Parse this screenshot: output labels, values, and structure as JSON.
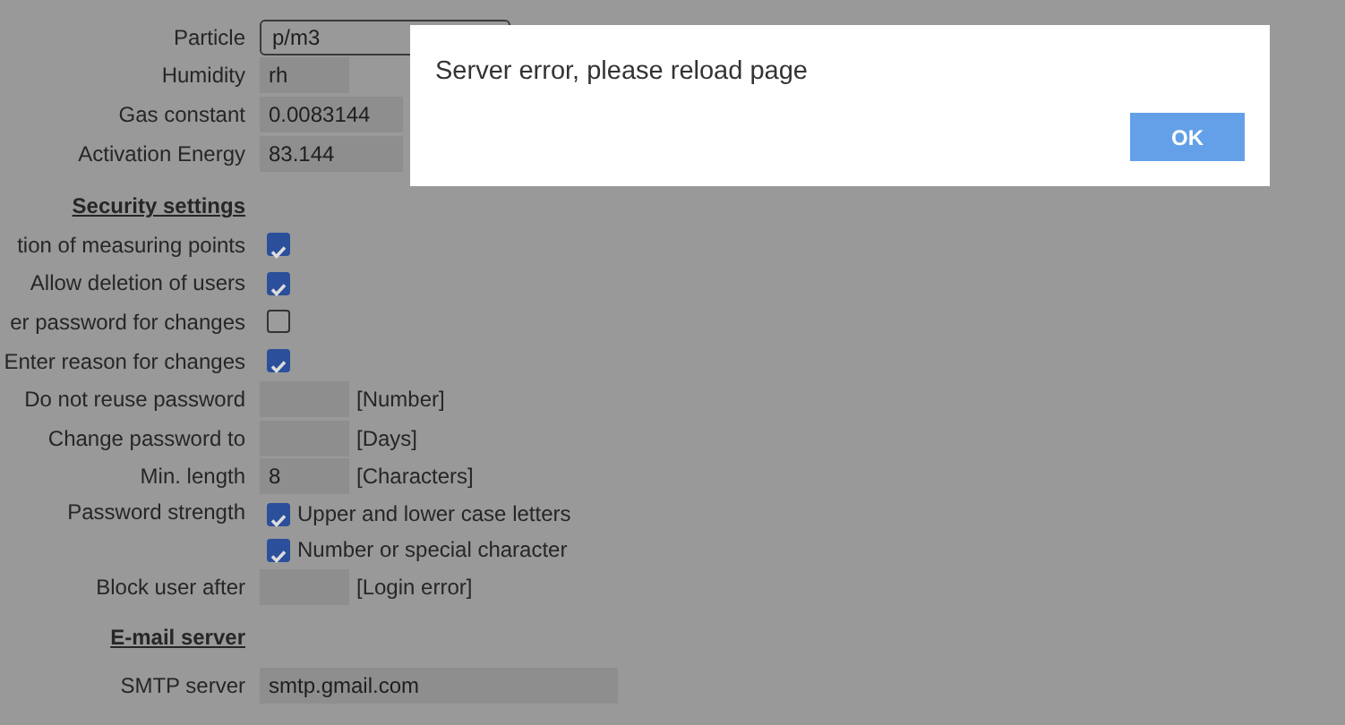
{
  "form": {
    "rows": [
      {
        "kind": "select",
        "label": "Particle",
        "value": "p/m3"
      },
      {
        "kind": "field",
        "label": "Humidity",
        "value": "rh"
      },
      {
        "kind": "number",
        "label": "Gas constant",
        "value": "0.0083144"
      },
      {
        "kind": "number",
        "label": "Activation Energy",
        "value": "83.144"
      },
      {
        "kind": "heading",
        "label": "Security settings"
      },
      {
        "kind": "check",
        "label": "tion of measuring points",
        "checked": true
      },
      {
        "kind": "check",
        "label": "Allow deletion of users",
        "checked": true
      },
      {
        "kind": "check",
        "label": "er password for changes",
        "checked": false
      },
      {
        "kind": "check",
        "label": "Enter reason for changes",
        "checked": true
      },
      {
        "kind": "field",
        "label": "Do not reuse password",
        "unit": "[Number]"
      },
      {
        "kind": "field",
        "label": "Change password to",
        "unit": "[Days]"
      },
      {
        "kind": "field",
        "label": "Min. length",
        "value": "8",
        "unit": "[Characters]"
      },
      {
        "kind": "options",
        "label": "Password strength",
        "options": [
          {
            "label": "Upper and lower case letters",
            "checked": true
          },
          {
            "label": "Number or special character",
            "checked": true
          }
        ]
      },
      {
        "kind": "field",
        "label": "Block user after",
        "unit": "[Login error]"
      },
      {
        "kind": "heading",
        "label": "E-mail server"
      },
      {
        "kind": "text",
        "label": "SMTP server",
        "value": "smtp.gmail.com"
      }
    ]
  },
  "dialog": {
    "message": "Server error, please reload page",
    "button": "OK"
  }
}
